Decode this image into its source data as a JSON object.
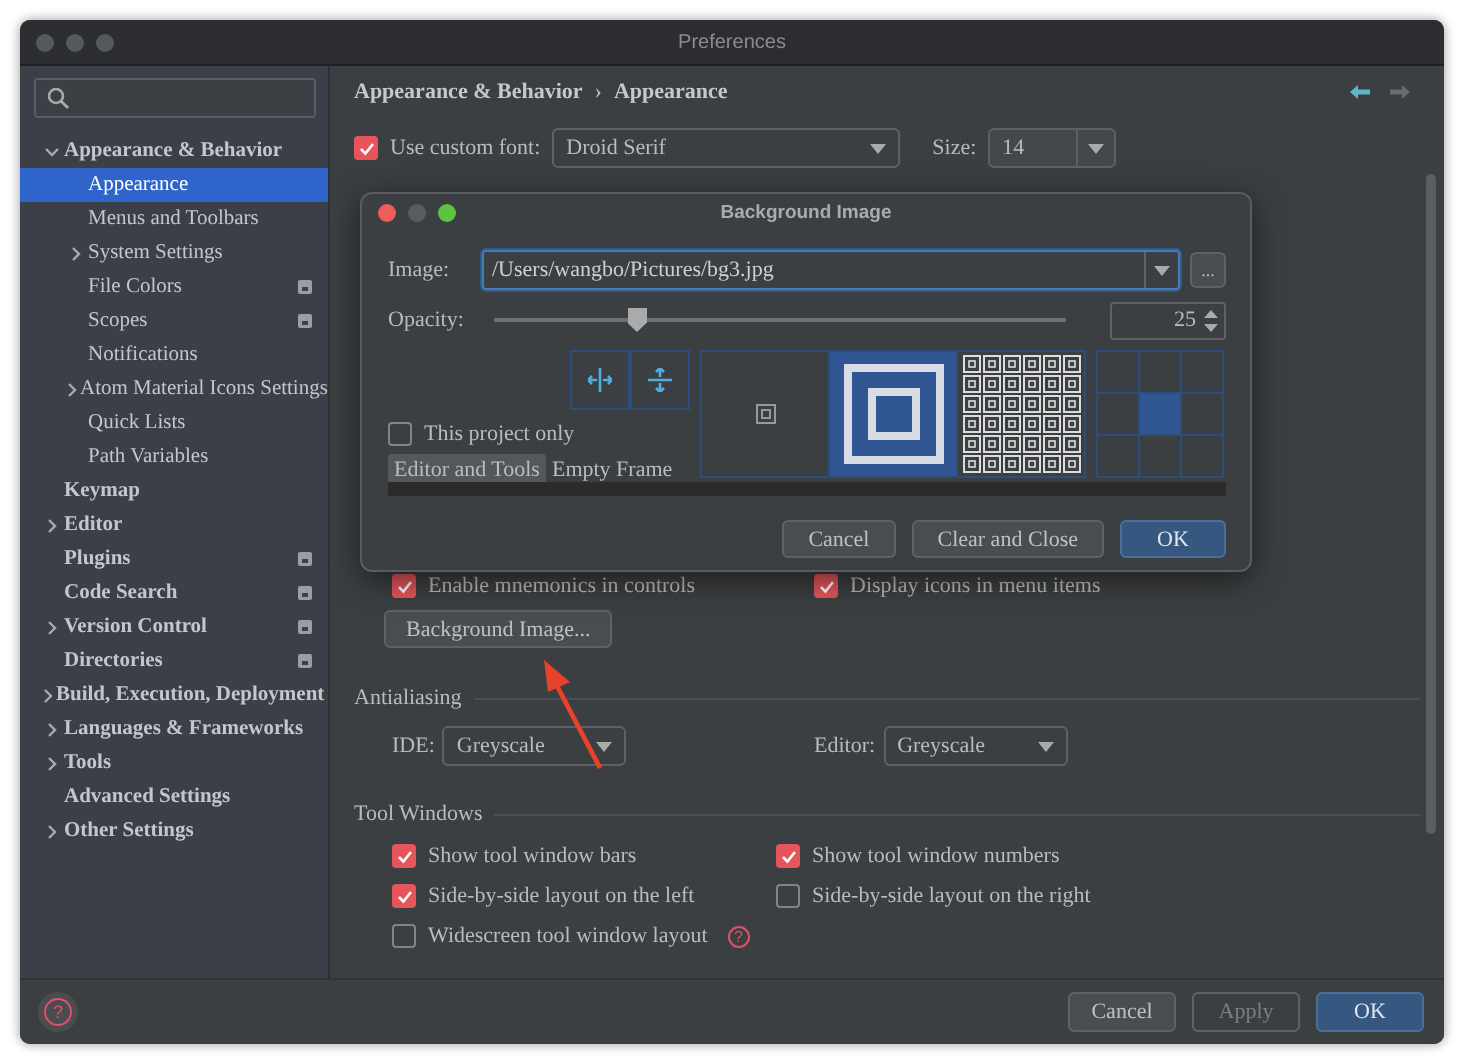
{
  "window": {
    "title": "Preferences"
  },
  "sidebar": {
    "items": [
      {
        "label": "Appearance & Behavior",
        "kind": "node",
        "expanded": true,
        "selected": false,
        "badge": false,
        "children": [
          {
            "label": "Appearance",
            "kind": "leaf",
            "selected": true,
            "badge": false
          },
          {
            "label": "Menus and Toolbars",
            "kind": "leaf",
            "selected": false,
            "badge": false
          },
          {
            "label": "System Settings",
            "kind": "node",
            "expanded": false,
            "selected": false,
            "badge": false
          },
          {
            "label": "File Colors",
            "kind": "leaf",
            "selected": false,
            "badge": true
          },
          {
            "label": "Scopes",
            "kind": "leaf",
            "selected": false,
            "badge": true
          },
          {
            "label": "Notifications",
            "kind": "leaf",
            "selected": false,
            "badge": false
          },
          {
            "label": "Atom Material Icons Settings",
            "kind": "node",
            "expanded": false,
            "selected": false,
            "badge": false
          },
          {
            "label": "Quick Lists",
            "kind": "leaf",
            "selected": false,
            "badge": false
          },
          {
            "label": "Path Variables",
            "kind": "leaf",
            "selected": false,
            "badge": false
          }
        ]
      },
      {
        "label": "Keymap",
        "kind": "leaf",
        "selected": false,
        "badge": false
      },
      {
        "label": "Editor",
        "kind": "node",
        "expanded": false,
        "selected": false,
        "badge": false
      },
      {
        "label": "Plugins",
        "kind": "leaf",
        "selected": false,
        "badge": true
      },
      {
        "label": "Code Search",
        "kind": "leaf",
        "selected": false,
        "badge": true
      },
      {
        "label": "Version Control",
        "kind": "node",
        "expanded": false,
        "selected": false,
        "badge": true
      },
      {
        "label": "Directories",
        "kind": "leaf",
        "selected": false,
        "badge": true
      },
      {
        "label": "Build, Execution, Deployment",
        "kind": "node",
        "expanded": false,
        "selected": false,
        "badge": false
      },
      {
        "label": "Languages & Frameworks",
        "kind": "node",
        "expanded": false,
        "selected": false,
        "badge": false
      },
      {
        "label": "Tools",
        "kind": "node",
        "expanded": false,
        "selected": false,
        "badge": false
      },
      {
        "label": "Advanced Settings",
        "kind": "leaf",
        "selected": false,
        "badge": false
      },
      {
        "label": "Other Settings",
        "kind": "node",
        "expanded": false,
        "selected": false,
        "badge": false
      }
    ]
  },
  "breadcrumb": {
    "items": [
      "Appearance & Behavior",
      "Appearance"
    ],
    "separator": "›"
  },
  "font": {
    "checked": true,
    "label": "Use custom font:",
    "value": "Droid Serif",
    "size_label": "Size:",
    "size_value": "14"
  },
  "options": [
    {
      "label": "Enable mnemonics in controls",
      "checked": true
    },
    {
      "label": "Display icons in menu items",
      "checked": true
    }
  ],
  "background_button": "Background Image...",
  "antialiasing": {
    "title": "Antialiasing",
    "ide_label": "IDE:",
    "ide_value": "Greyscale",
    "editor_label": "Editor:",
    "editor_value": "Greyscale"
  },
  "tool_windows": {
    "title": "Tool Windows",
    "options": [
      {
        "label": "Show tool window bars",
        "checked": true
      },
      {
        "label": "Show tool window numbers",
        "checked": true
      },
      {
        "label": "Side-by-side layout on the left",
        "checked": true
      },
      {
        "label": "Side-by-side layout on the right",
        "checked": false
      },
      {
        "label": "Widescreen tool window layout",
        "checked": false,
        "help": "?"
      }
    ]
  },
  "footer": {
    "help": "?",
    "buttons": [
      {
        "label": "Cancel",
        "primary": false,
        "disabled": false
      },
      {
        "label": "Apply",
        "primary": false,
        "disabled": true
      },
      {
        "label": "OK",
        "primary": true,
        "disabled": false
      }
    ]
  },
  "dialog": {
    "title": "Background Image",
    "image_label": "Image:",
    "image_value": "/Users/wangbo/Pictures/bg3.jpg",
    "browse": "...",
    "opacity_label": "Opacity:",
    "opacity": {
      "level": 0.25,
      "reading": "25"
    },
    "project_only": {
      "label": "This project only",
      "checked": false
    },
    "targets": [
      {
        "label": "Editor and Tools",
        "selected": true
      },
      {
        "label": "Empty Frame",
        "selected": false
      }
    ],
    "fill_modes": [
      {
        "kind": "center",
        "selected": false
      },
      {
        "kind": "scale",
        "selected": true
      },
      {
        "kind": "tile",
        "selected": false
      }
    ],
    "anchors": [
      {
        "selected": false
      },
      {
        "selected": false
      },
      {
        "selected": false
      },
      {
        "selected": false
      },
      {
        "selected": true
      },
      {
        "selected": false
      },
      {
        "selected": false
      },
      {
        "selected": false
      },
      {
        "selected": false
      }
    ],
    "buttons": [
      {
        "label": "Cancel",
        "primary": false
      },
      {
        "label": "Clear and Close",
        "primary": false
      },
      {
        "label": "OK",
        "primary": true
      }
    ]
  }
}
